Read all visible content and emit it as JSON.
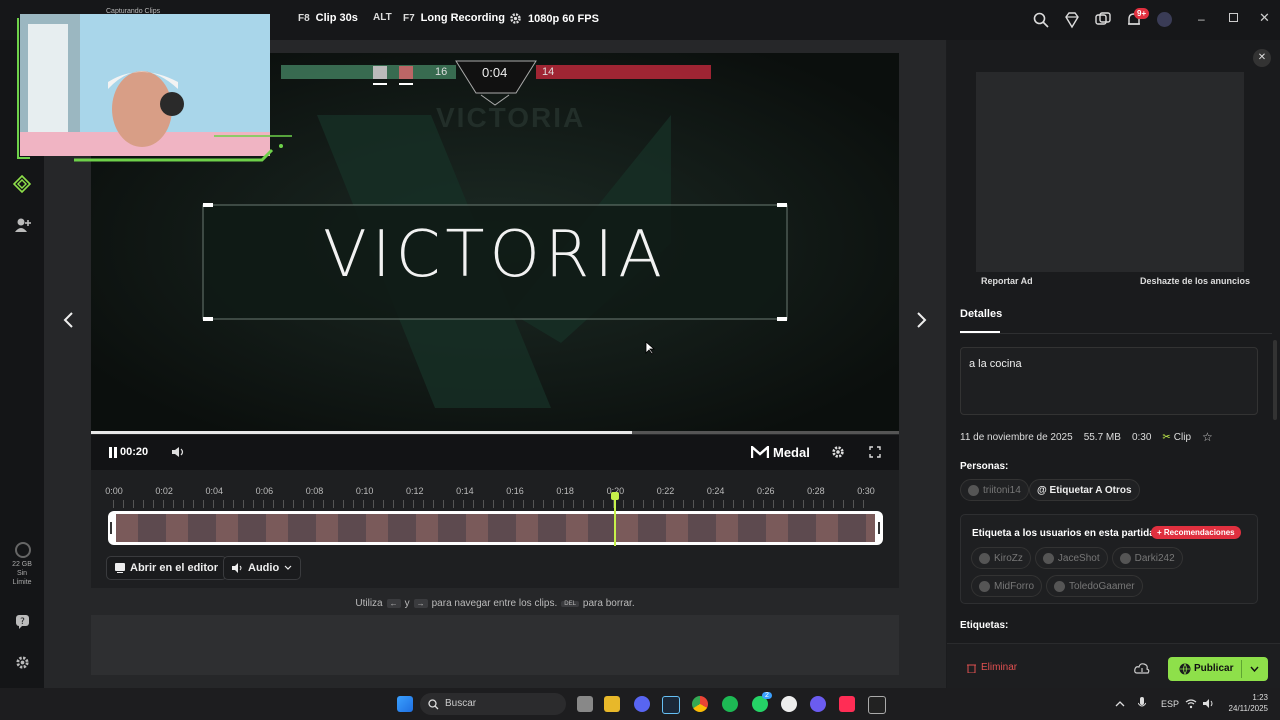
{
  "topbar": {
    "capture_status": "Capturando Clips",
    "hotkeys": [
      {
        "key": "F8",
        "label": "Clip 30s"
      },
      {
        "key": "ALT",
        "label": ""
      },
      {
        "key": "F7",
        "label": "Long Recording"
      }
    ],
    "quality": "1080p 60 FPS",
    "notifications_badge": "9+"
  },
  "sidebar": {
    "storage_value": "22 GB",
    "storage_label_1": "Sin",
    "storage_label_2": "Límite"
  },
  "game_hud": {
    "score_left": "16",
    "score_right": "14",
    "round_timer": "0:04",
    "banner_text": "VICTORIA",
    "watermark_text": "VICTORIA"
  },
  "player_controls": {
    "current_time": "00:20",
    "progress": 0.67,
    "brand": "Medal"
  },
  "timeline": {
    "ticks": [
      "0:00",
      "0:02",
      "0:04",
      "0:06",
      "0:08",
      "0:10",
      "0:12",
      "0:14",
      "0:16",
      "0:18",
      "0:20",
      "0:22",
      "0:24",
      "0:26",
      "0:28",
      "0:30"
    ],
    "playhead_time": "0:20",
    "open_editor_label": "Abrir en el editor",
    "audio_label": "Audio"
  },
  "hint": {
    "prefix": "Utiliza",
    "and": "y",
    "middle": "para navegar entre los clips.",
    "del_key": "DEL",
    "suffix": "para borrar."
  },
  "right_panel": {
    "report_ad": "Reportar Ad",
    "remove_ads": "Deshazte de los anuncios",
    "details_tab": "Detalles",
    "title_value": "a la cocina",
    "date": "11 de noviembre de 2025",
    "size": "55.7 MB",
    "duration": "0:30",
    "type": "Clip",
    "people_label": "Personas:",
    "person_chip": "triitoni14",
    "tag_others": "@ Etiquetar A Otros",
    "tag_match_title": "Etiqueta a los usuarios en esta partida",
    "recommendations_badge": "Recomendaciones",
    "match_users": [
      "KiroZz",
      "JaceShot",
      "Darki242",
      "MidForro",
      "ToledoGaamer"
    ],
    "tags_label": "Etiquetas:",
    "delete_label": "Eliminar",
    "publish_label": "Publicar"
  },
  "taskbar": {
    "search_placeholder": "Buscar",
    "language": "ESP",
    "time": "1:23",
    "date": "24/11/2025",
    "whatsapp_badge": "2"
  },
  "colors": {
    "accent_green": "#8ee04a",
    "team_green": "#3f7a5c",
    "team_red": "#b8283a",
    "recommend_red": "#e0303f"
  }
}
